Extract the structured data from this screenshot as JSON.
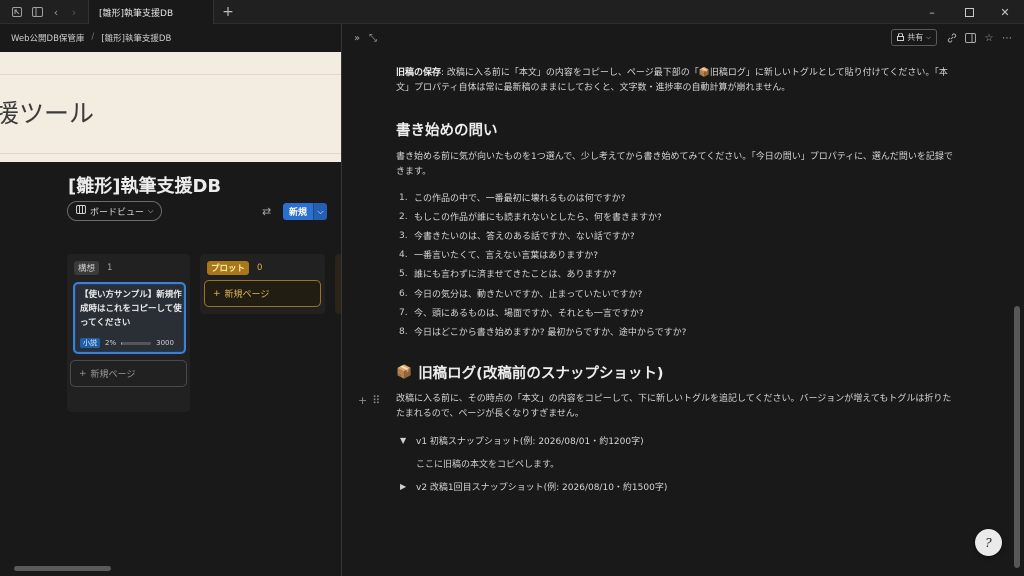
{
  "titlebar": {
    "tab_title": "[雛形]執筆支援DB",
    "new_tab": "+",
    "icons": [
      "app-icon",
      "sidebar-toggle-icon",
      "back-icon",
      "forward-icon"
    ],
    "window_controls": [
      "minimize-icon",
      "maximize-icon",
      "close-icon"
    ]
  },
  "left": {
    "breadcrumb": [
      "Web公開DB保管庫",
      "/",
      "[雛形]執筆支援DB"
    ],
    "cover_text": "援ツール",
    "db_title": "[雛形]執筆支援DB",
    "view_label": "ボードビュー",
    "new_button": "新規",
    "columns": [
      {
        "tag": "構想",
        "count": "1"
      },
      {
        "tag": "プロット",
        "count": "0"
      }
    ],
    "card": {
      "title": "【使い方サンプル】新規作成時はこれをコピーして使ってください",
      "tag": "小説",
      "progress_label": "2%",
      "progress": 0.02,
      "word_count": "3000"
    },
    "new_page_label": "新規ページ",
    "colors": {
      "accent": "#2b6fd0",
      "gold": "#a87818",
      "cover": "#f3ece0"
    }
  },
  "right": {
    "share_label": "共有",
    "intro_bold": "旧稿の保存",
    "intro_rest": ": 改稿に入る前に「本文」の内容をコピーし、ページ最下部の「📦旧稿ログ」に新しいトグルとして貼り付けてください。「本文」プロパティ自体は常に最新稿のままにしておくと、文字数・進捗率の自動計算が崩れません。",
    "section1_heading": "書き始めの問い",
    "section1_para": "書き始める前に気が向いたものを1つ選んで、少し考えてから書き始めてみてください。「今日の問い」プロパティに、選んだ問いを記録できます。",
    "questions": [
      "この作品の中で、一番最初に壊れるものは何ですか?",
      "もしこの作品が誰にも読まれないとしたら、何を書きますか?",
      "今書きたいのは、答えのある話ですか、ない話ですか?",
      "一番言いたくて、言えない言葉はありますか?",
      "誰にも言わずに済ませてきたことは、ありますか?",
      "今日の気分は、動きたいですか、止まっていたいですか?",
      "今、頭にあるものは、場面ですか、それとも一言ですか?",
      "今日はどこから書き始めますか? 最初からですか、途中からですか?"
    ],
    "section2_icon": "📦",
    "section2_heading": "旧稿ログ(改稿前のスナップショット)",
    "section2_para": "改稿に入る前に、その時点の「本文」の内容をコピーして、下に新しいトグルを追記してください。バージョンが増えてもトグルは折りたたまれるので、ページが長くなりすぎません。",
    "toggles": [
      {
        "label": "v1 初稿スナップショット(例: 2026/08/01・約1200字)",
        "open": true,
        "body": "ここに旧稿の本文をコピペします。"
      },
      {
        "label": "v2 改稿1回目スナップショット(例: 2026/08/10・約1500字)",
        "open": false
      }
    ],
    "help_icon": "?"
  }
}
